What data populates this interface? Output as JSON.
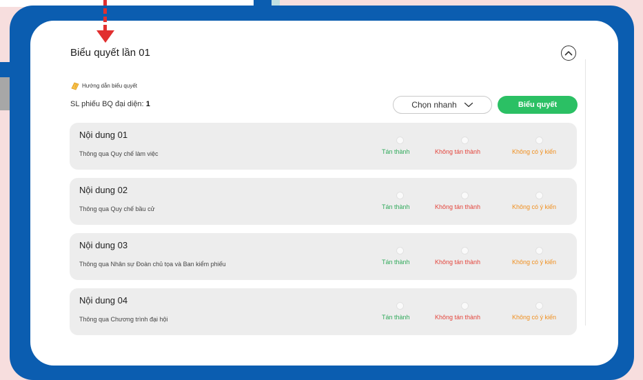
{
  "panel": {
    "title": "Biểu quyết lần 01",
    "guide_label": "Hướng dẫn biểu quyết",
    "sl_label": "SL phiếu BQ đại diện:",
    "sl_value": "1"
  },
  "toolbar": {
    "quick_select_label": "Chọn nhanh",
    "vote_button_label": "Biểu quyết"
  },
  "options": {
    "agree": "Tán thành",
    "disagree": "Không tán thành",
    "no_opinion": "Không có ý kiến"
  },
  "items": [
    {
      "title": "Nội dung 01",
      "desc": "Thông qua Quy chế làm việc"
    },
    {
      "title": "Nội dung 02",
      "desc": "Thông qua Quy chế bầu cử"
    },
    {
      "title": "Nội dung 03",
      "desc": "Thông qua Nhân sự Đoàn chủ tọa và Ban kiểm phiếu"
    },
    {
      "title": "Nội dung 04",
      "desc": "Thông qua Chương trình đại hội"
    }
  ],
  "colors": {
    "frame_blue": "#0b5db0",
    "vote_green": "#2bc064",
    "agree_green": "#2fa95a",
    "disagree_red": "#e3453c",
    "no_opinion_orange": "#f08f1e",
    "pointer_red": "#e12f2f"
  }
}
